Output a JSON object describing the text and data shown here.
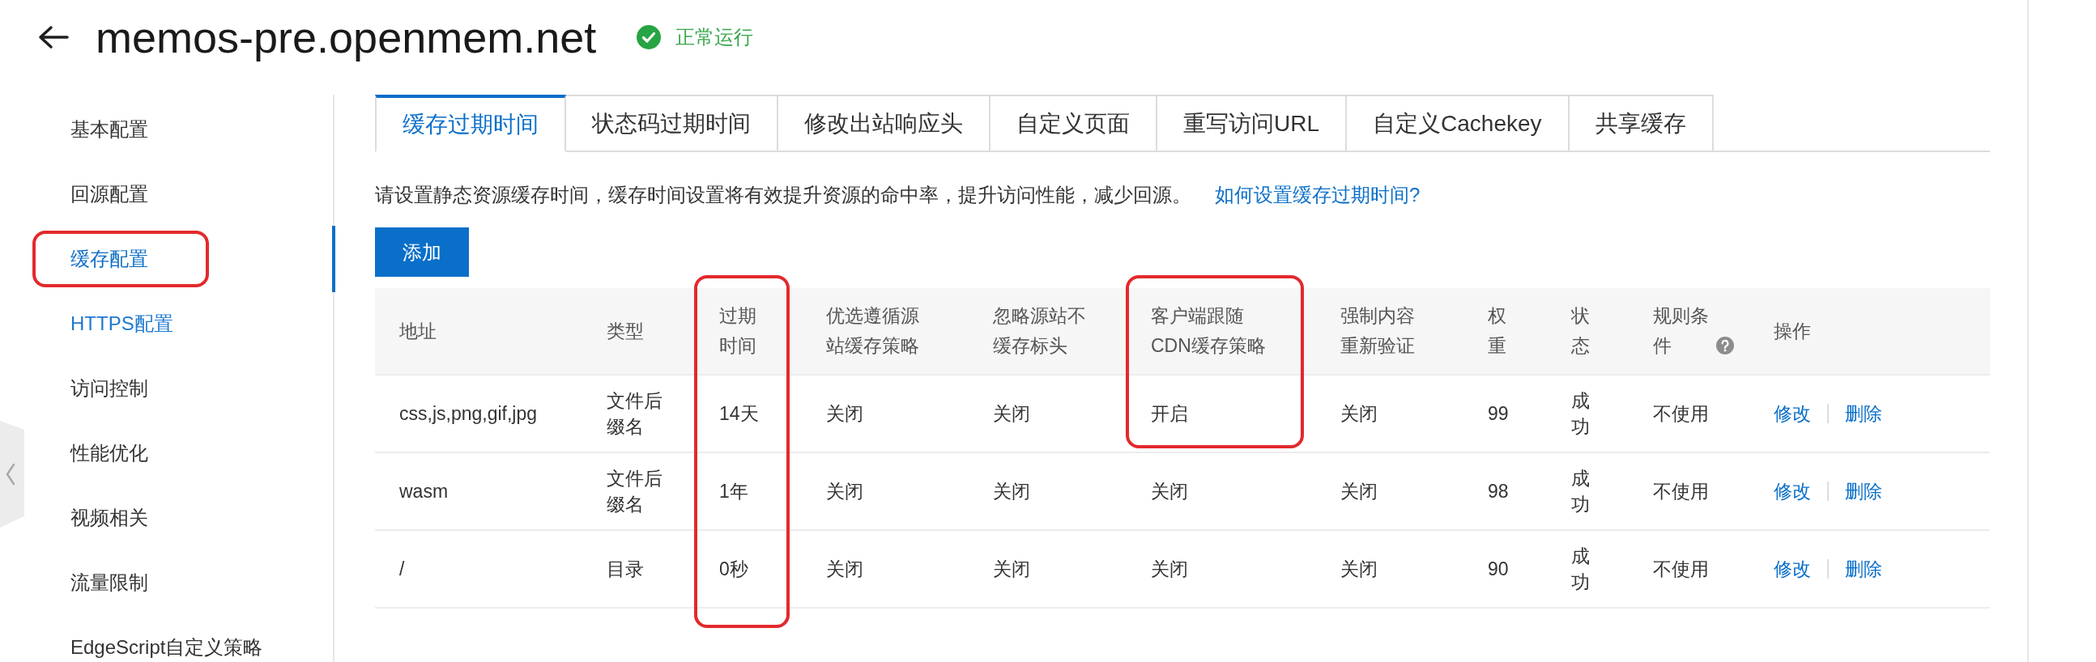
{
  "header": {
    "title": "memos-pre.openmem.net",
    "status": {
      "label": "正常运行",
      "kind": "ok"
    }
  },
  "sidebar": {
    "items": [
      {
        "label": "基本配置",
        "selected": false,
        "hovered": false,
        "outlined": false
      },
      {
        "label": "回源配置",
        "selected": false,
        "hovered": false,
        "outlined": false
      },
      {
        "label": "缓存配置",
        "selected": true,
        "hovered": false,
        "outlined": true
      },
      {
        "label": "HTTPS配置",
        "selected": false,
        "hovered": true,
        "outlined": false
      },
      {
        "label": "访问控制",
        "selected": false,
        "hovered": false,
        "outlined": false
      },
      {
        "label": "性能优化",
        "selected": false,
        "hovered": false,
        "outlined": false
      },
      {
        "label": "视频相关",
        "selected": false,
        "hovered": false,
        "outlined": false
      },
      {
        "label": "流量限制",
        "selected": false,
        "hovered": false,
        "outlined": false
      },
      {
        "label": "EdgeScript自定义策略",
        "selected": false,
        "hovered": false,
        "outlined": false
      }
    ]
  },
  "tabs": [
    {
      "label": "缓存过期时间",
      "selected": true
    },
    {
      "label": "状态码过期时间",
      "selected": false
    },
    {
      "label": "修改出站响应头",
      "selected": false
    },
    {
      "label": "自定义页面",
      "selected": false
    },
    {
      "label": "重写访问URL",
      "selected": false
    },
    {
      "label": "自定义Cachekey",
      "selected": false
    },
    {
      "label": "共享缓存",
      "selected": false
    }
  ],
  "notice": {
    "text": "请设置静态资源缓存时间，缓存时间设置将有效提升资源的命中率，提升访问性能，减少回源。",
    "link": "如何设置缓存过期时间?"
  },
  "add_button": "添加",
  "table": {
    "columns": [
      {
        "label": "地址",
        "help": false,
        "outlined": false
      },
      {
        "label": "类型",
        "help": false,
        "outlined": false
      },
      {
        "label": "过期时间",
        "help": false,
        "outlined": true
      },
      {
        "label": "优选遵循源站缓存策略",
        "help": false,
        "outlined": false
      },
      {
        "label": "忽略源站不缓存标头",
        "help": false,
        "outlined": false
      },
      {
        "label": "客户端跟随CDN缓存策略",
        "help": false,
        "outlined": true
      },
      {
        "label": "强制内容重新验证",
        "help": false,
        "outlined": false
      },
      {
        "label": "权重",
        "help": false,
        "outlined": false
      },
      {
        "label": "状态",
        "help": false,
        "outlined": false
      },
      {
        "label": "规则条件",
        "help": true,
        "outlined": false
      },
      {
        "label": "操作",
        "help": false,
        "outlined": false
      }
    ],
    "rows": [
      {
        "cells": [
          "css,js,png,gif,jpg",
          "文件后缀名",
          "14天",
          "关闭",
          "关闭",
          "开启",
          "关闭",
          "99",
          "成功",
          "不使用"
        ],
        "outlined": [
          false,
          false,
          true,
          false,
          false,
          true,
          false,
          false,
          false,
          false
        ],
        "actions": [
          "修改",
          "删除"
        ]
      },
      {
        "cells": [
          "wasm",
          "文件后缀名",
          "1年",
          "关闭",
          "关闭",
          "关闭",
          "关闭",
          "98",
          "成功",
          "不使用"
        ],
        "outlined": [
          false,
          false,
          true,
          false,
          false,
          false,
          false,
          false,
          false,
          false
        ],
        "actions": [
          "修改",
          "删除"
        ]
      },
      {
        "cells": [
          "/",
          "目录",
          "0秒",
          "关闭",
          "关闭",
          "关闭",
          "关闭",
          "90",
          "成功",
          "不使用"
        ],
        "outlined": [
          false,
          false,
          true,
          false,
          false,
          false,
          false,
          false,
          false,
          false
        ],
        "actions": [
          "修改",
          "删除"
        ]
      }
    ]
  }
}
